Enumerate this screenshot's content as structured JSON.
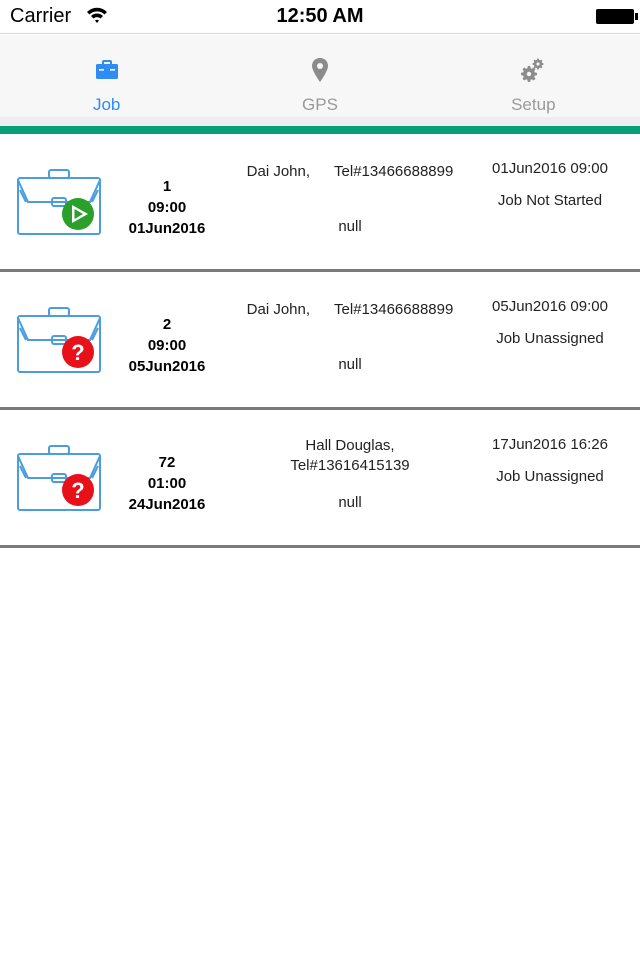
{
  "status_bar": {
    "carrier": "Carrier",
    "time": "12:50 AM",
    "wifi_icon": "wifi-icon",
    "battery_icon": "battery-icon"
  },
  "tabs": [
    {
      "label": "Job",
      "icon": "briefcase-icon",
      "active": true
    },
    {
      "label": "GPS",
      "icon": "map-pin-icon",
      "active": false
    },
    {
      "label": "Setup",
      "icon": "gears-icon",
      "active": false
    }
  ],
  "colors": {
    "accent_bar": "#06a078",
    "active_tab": "#2f8cf2",
    "inactive_tab": "#9a9a9a",
    "icon_outline": "#4a9de0",
    "status_started": "#2aa02a",
    "status_unknown": "#e8111a"
  },
  "jobs": [
    {
      "id": "1",
      "time": "09:00",
      "date": "01Jun2016",
      "name": "Dai John,",
      "tel": "Tel#13466688899",
      "note": "null",
      "datetime": "01Jun2016 09:00",
      "status": "Job Not Started",
      "badge": "play-icon"
    },
    {
      "id": "2",
      "time": "09:00",
      "date": "05Jun2016",
      "name": "Dai John,",
      "tel": "Tel#13466688899",
      "note": "null",
      "datetime": "05Jun2016 09:00",
      "status": "Job Unassigned",
      "badge": "question-icon"
    },
    {
      "id": "72",
      "time": "01:00",
      "date": "24Jun2016",
      "name": "Hall Douglas,",
      "tel": "Tel#13616415139",
      "note": "null",
      "datetime": "17Jun2016 16:26",
      "status": "Job Unassigned",
      "badge": "question-icon"
    }
  ]
}
